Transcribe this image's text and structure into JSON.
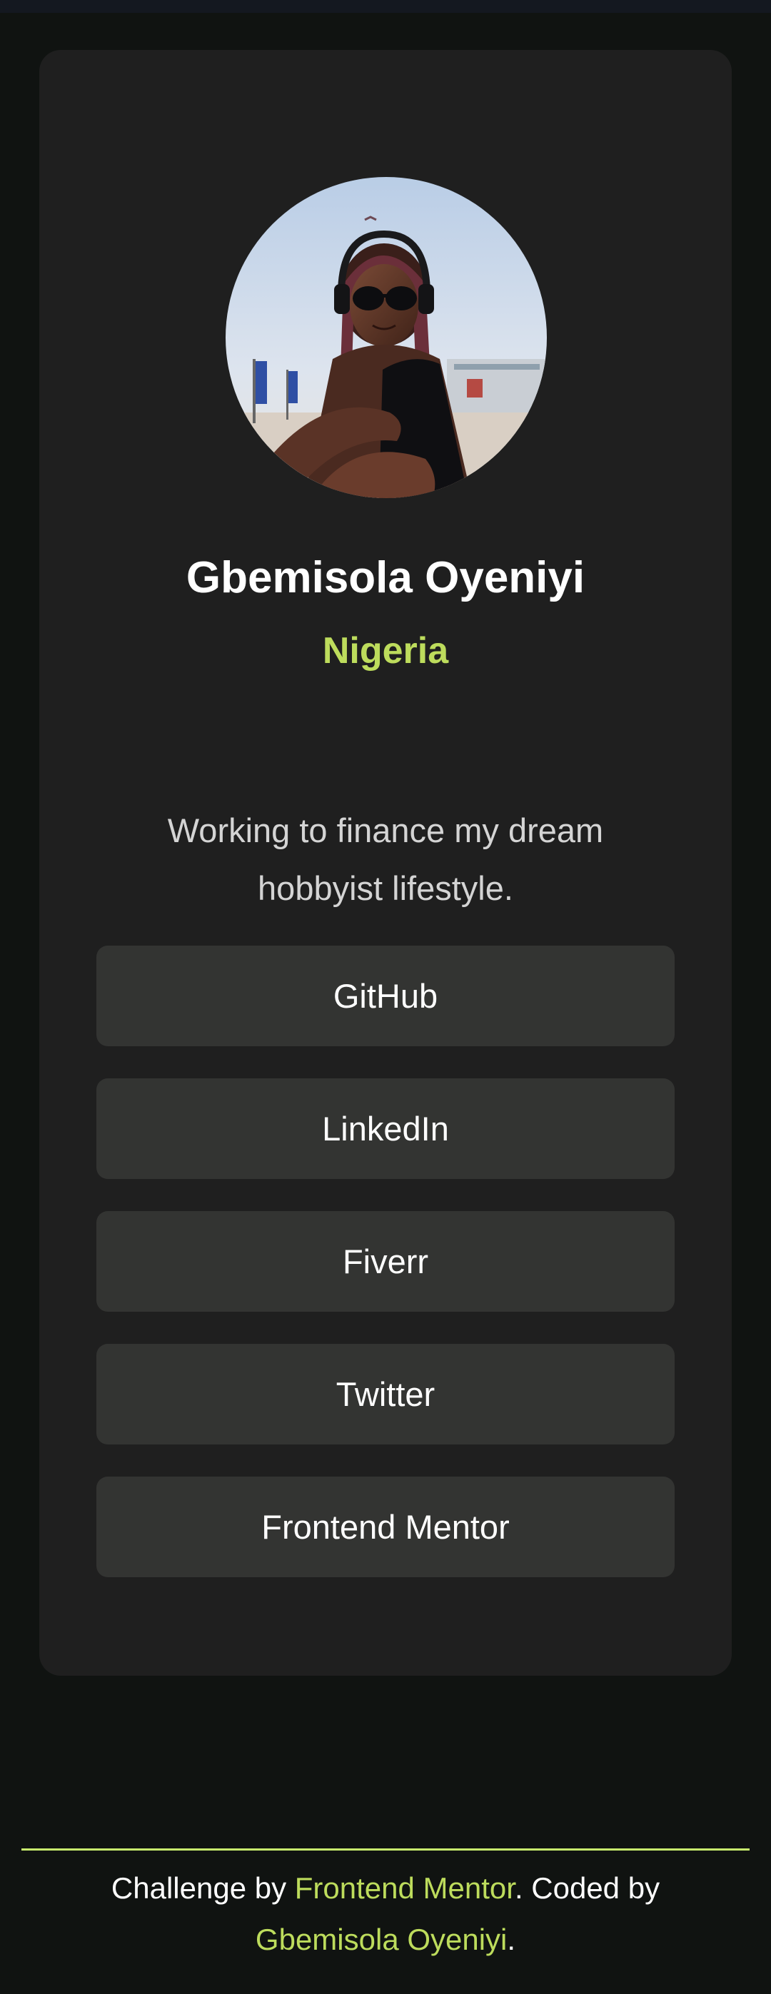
{
  "profile": {
    "name": "Gbemisola Oyeniyi",
    "location": "Nigeria",
    "bio": "Working to finance my dream hobbyist lifestyle.",
    "avatar_icon": "profile-photo"
  },
  "links": [
    {
      "label": "GitHub"
    },
    {
      "label": "LinkedIn"
    },
    {
      "label": "Fiverr"
    },
    {
      "label": "Twitter"
    },
    {
      "label": "Frontend Mentor"
    }
  ],
  "footer": {
    "prefix": "Challenge by ",
    "challenge_link": "Frontend Mentor",
    "middle": ". Coded by ",
    "author_link": "Gbemisola Oyeniyi",
    "suffix": "."
  },
  "colors": {
    "background": "#101311",
    "card": "#1f1f1f",
    "button": "#333432",
    "accent": "#bddc5c",
    "text": "#ffffff"
  }
}
